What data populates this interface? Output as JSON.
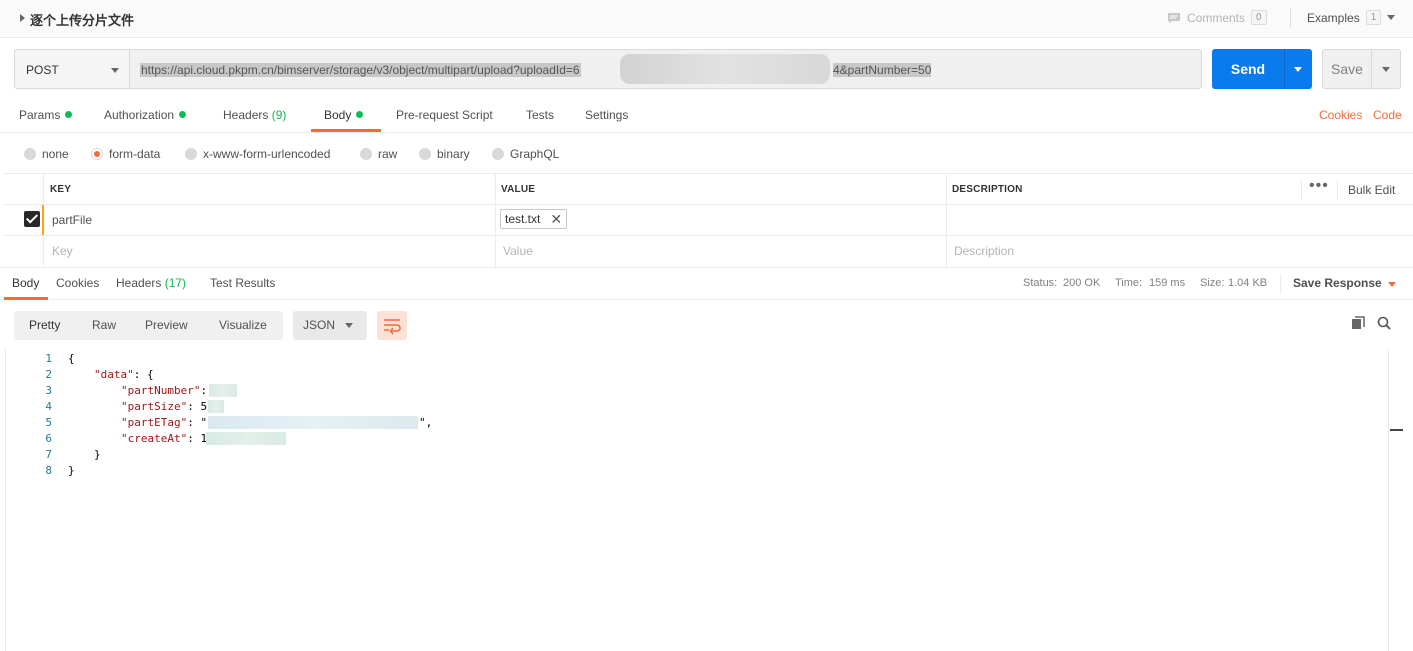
{
  "request": {
    "name": "逐个上传分片文件",
    "comments_label": "Comments",
    "comments_count": "0",
    "examples_label": "Examples",
    "examples_count": "1",
    "method": "POST",
    "url_visible_start": "https://api.cloud.pkpm.cn/bimserver/storage/v3/object/multipart/upload?uploadId=6",
    "url_visible_end": "4&partNumber=50",
    "send_label": "Send",
    "save_label": "Save"
  },
  "request_tabs": {
    "params": "Params",
    "authorization": "Authorization",
    "headers": "Headers",
    "headers_count": "(9)",
    "body": "Body",
    "pre_request": "Pre-request Script",
    "tests": "Tests",
    "settings": "Settings",
    "cookies_link": "Cookies",
    "code_link": "Code"
  },
  "body_types": [
    "none",
    "form-data",
    "x-www-form-urlencoded",
    "raw",
    "binary",
    "GraphQL"
  ],
  "body_type_selected": "form-data",
  "form_table": {
    "headers": {
      "key": "KEY",
      "value": "VALUE",
      "description": "DESCRIPTION"
    },
    "bulk_edit": "Bulk Edit",
    "rows": [
      {
        "key": "partFile",
        "value_file": "test.txt",
        "checked": true
      }
    ],
    "placeholder": {
      "key": "Key",
      "value": "Value",
      "description": "Description"
    }
  },
  "response_tabs": {
    "body": "Body",
    "cookies": "Cookies",
    "headers": "Headers",
    "headers_count": "(17)",
    "test_results": "Test Results",
    "status_label": "Status:",
    "status_value": "200 OK",
    "time_label": "Time:",
    "time_value": "159 ms",
    "size_label": "Size:",
    "size_value": "1.04 KB",
    "save_response": "Save Response"
  },
  "view_modes": [
    "Pretty",
    "Raw",
    "Preview",
    "Visualize"
  ],
  "format": "JSON",
  "code_lines": [
    {
      "n": "1",
      "text": "{"
    },
    {
      "n": "2",
      "key": "\"data\"",
      "rest": ": {"
    },
    {
      "n": "3",
      "key": "\"partNumber\"",
      "rest": ":"
    },
    {
      "n": "4",
      "key": "\"partSize\"",
      "rest": ": 5"
    },
    {
      "n": "5",
      "key": "\"partETag\"",
      "rest": ": \""
    },
    {
      "n": "6",
      "key": "\"createAt\"",
      "rest": ": 1"
    },
    {
      "n": "7",
      "text": "}"
    },
    {
      "n": "8",
      "text": "}"
    }
  ],
  "line5_suffix": "\",",
  "colors": {
    "accent": "#f26b3a",
    "send": "#097bed",
    "status_green": "#0cbb52"
  }
}
